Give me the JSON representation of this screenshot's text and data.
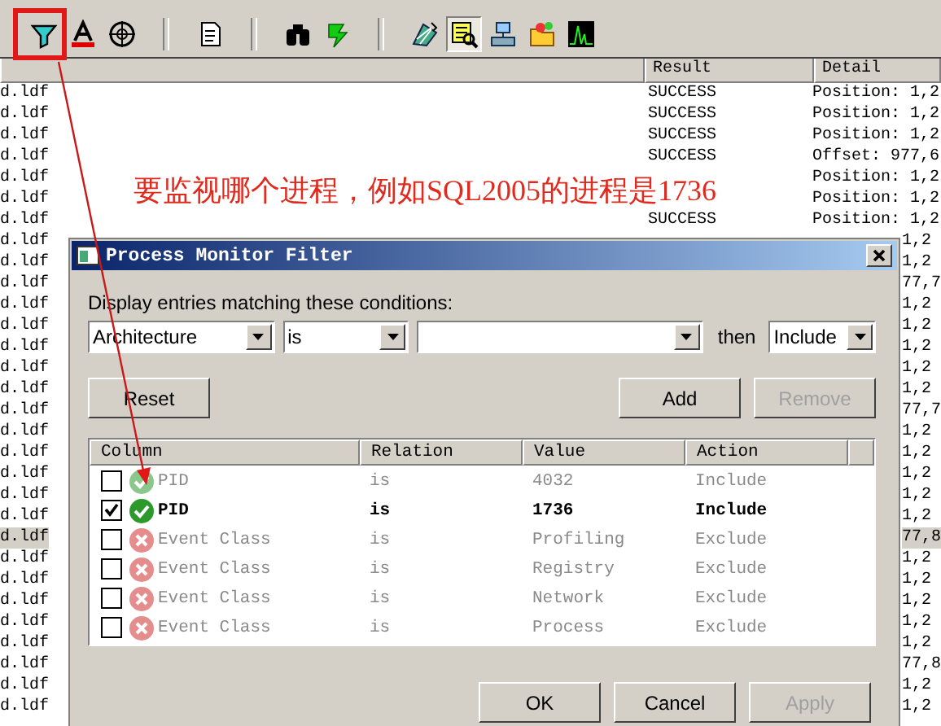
{
  "toolbar": {
    "groups": [
      [
        {
          "selected": false
        },
        {
          "selected": false
        },
        {
          "selected": false
        }
      ],
      [
        {
          "selected": false
        }
      ],
      [
        {
          "selected": false
        },
        {
          "selected": false
        }
      ],
      [
        {
          "selected": false
        },
        {
          "selected": true
        },
        {
          "selected": false
        },
        {
          "selected": false
        },
        {
          "selected": false
        }
      ]
    ]
  },
  "log_table": {
    "columns": [
      "Result",
      "Detail"
    ],
    "rows": [
      {
        "kind": "full",
        "column_1": "d.ldf",
        "result": "SUCCESS",
        "detail": "Position: 1,2",
        "selected": false
      },
      {
        "kind": "full",
        "column_1": "d.ldf",
        "result": "SUCCESS",
        "detail": "Position: 1,2",
        "selected": false
      },
      {
        "kind": "full",
        "column_1": "d.ldf",
        "result": "SUCCESS",
        "detail": "Position: 1,2",
        "selected": false
      },
      {
        "kind": "full",
        "column_1": "d.ldf",
        "result": "SUCCESS",
        "detail": "Offset: 977,6",
        "selected": false
      },
      {
        "kind": "full",
        "column_1": "d.ldf",
        "detail": "Position: 1,2",
        "selected": false
      },
      {
        "kind": "full",
        "column_1": "d.ldf",
        "detail": "Position: 1,2",
        "selected": false
      },
      {
        "kind": "full",
        "column_1": "d.ldf",
        "result": "SUCCESS",
        "detail": "Position: 1,2",
        "selected": false
      },
      {
        "column_1": "d.ldf",
        "detail": "1,2",
        "selected": false
      },
      {
        "column_1": "d.ldf",
        "detail": "1,2",
        "selected": false
      },
      {
        "column_1": "d.ldf",
        "detail": "77,7",
        "selected": false
      },
      {
        "column_1": "d.ldf",
        "detail": "1,2",
        "selected": false
      },
      {
        "column_1": "d.ldf",
        "detail": "1,2",
        "selected": false
      },
      {
        "column_1": "d.ldf",
        "detail": "1,2",
        "selected": false
      },
      {
        "column_1": "d.ldf",
        "detail": "1,2",
        "selected": false
      },
      {
        "column_1": "d.ldf",
        "detail": "1,2",
        "selected": false
      },
      {
        "column_1": "d.ldf",
        "detail": "77,7",
        "selected": false
      },
      {
        "column_1": "d.ldf",
        "detail": "1,2",
        "selected": false
      },
      {
        "column_1": "d.ldf",
        "detail": "1,2",
        "selected": false
      },
      {
        "column_1": "d.ldf",
        "detail": "1,2",
        "selected": false
      },
      {
        "column_1": "d.ldf",
        "detail": "1,2",
        "selected": false
      },
      {
        "column_1": "d.ldf",
        "detail": "1,2",
        "selected": false
      },
      {
        "column_1": "d.ldf",
        "detail": "77,8",
        "selected": true
      },
      {
        "column_1": "d.ldf",
        "detail": "1,2",
        "selected": false
      },
      {
        "column_1": "d.ldf",
        "detail": "1,2",
        "selected": false
      },
      {
        "column_1": "d.ldf",
        "detail": "1,2",
        "selected": false
      },
      {
        "column_1": "d.ldf",
        "detail": "1,2",
        "selected": false
      },
      {
        "column_1": "d.ldf",
        "detail": "1,2",
        "selected": false
      },
      {
        "column_1": "d.ldf",
        "detail": "77,8",
        "selected": false
      },
      {
        "column_1": "d.ldf",
        "detail": "1,2",
        "selected": false
      },
      {
        "column_1": "d.ldf",
        "detail": "1,2",
        "selected": false
      }
    ]
  },
  "annotation": {
    "text": "要监视哪个进程，例如SQL2005的进程是1736"
  },
  "dialog": {
    "title": "Process Monitor Filter",
    "prompt": "Display entries matching these conditions:",
    "condition": {
      "column": "Architecture",
      "relation": "is",
      "then_label": "then",
      "action": "Include"
    },
    "condition_buttons": [
      {
        "label": "Reset",
        "disabled": false
      },
      {
        "label": "Add",
        "disabled": false
      },
      {
        "label": "Remove",
        "disabled": true
      }
    ],
    "filter_list": {
      "columns": [
        "Column",
        "Relation",
        "Value",
        "Action"
      ],
      "rows": [
        {
          "checked": false,
          "kind": "include",
          "column": "PID",
          "relation": "is",
          "value": "4032",
          "action": "Include"
        },
        {
          "checked": true,
          "kind": "include",
          "column": "PID",
          "relation": "is",
          "value": "1736",
          "action": "Include"
        },
        {
          "checked": false,
          "kind": "exclude",
          "column": "Event Class",
          "relation": "is",
          "value": "Profiling",
          "action": "Exclude"
        },
        {
          "checked": false,
          "kind": "exclude",
          "column": "Event Class",
          "relation": "is",
          "value": "Registry",
          "action": "Exclude"
        },
        {
          "checked": false,
          "kind": "exclude",
          "column": "Event Class",
          "relation": "is",
          "value": "Network",
          "action": "Exclude"
        },
        {
          "checked": false,
          "kind": "exclude",
          "column": "Event Class",
          "relation": "is",
          "value": "Process",
          "action": "Exclude"
        }
      ]
    },
    "footer_buttons": [
      {
        "label": "OK",
        "disabled": false
      },
      {
        "label": "Cancel",
        "disabled": false
      },
      {
        "label": "Apply",
        "disabled": true
      }
    ]
  }
}
